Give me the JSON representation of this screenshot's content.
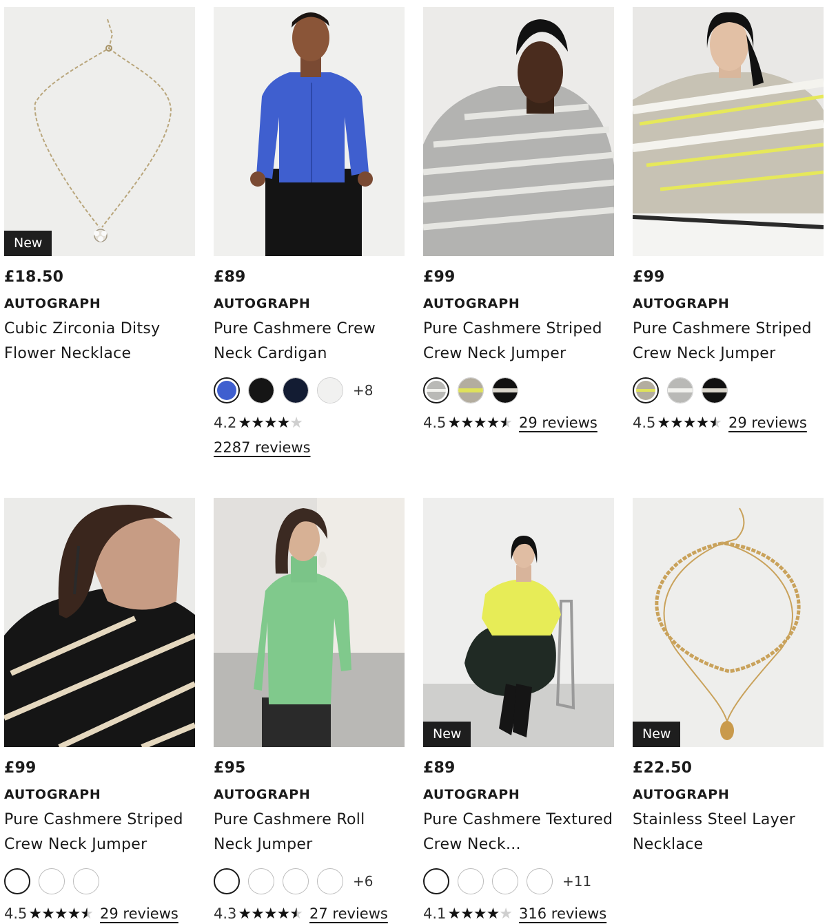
{
  "products": [
    {
      "price": "£18.50",
      "brand": "AUTOGRAPH",
      "title": "Cubic Zirconia Ditsy Flower Necklace",
      "badge": "New",
      "image": "necklace-flower-pendant"
    },
    {
      "price": "£89",
      "brand": "AUTOGRAPH",
      "title": "Pure Cashmere Crew Neck Cardigan",
      "swatches": [
        "#3f5fcf",
        "#151515",
        "#131c33",
        "#f1f1f0"
      ],
      "more_colours": "+8",
      "rating": "4.2",
      "rating_value": 4.2,
      "reviews": "2287 reviews",
      "image": "model-blue-cardigan"
    },
    {
      "price": "£99",
      "brand": "AUTOGRAPH",
      "title": "Pure Cashmere Striped Crew Neck Jumper",
      "swatches": [
        "grey-stripe",
        "oatmeal-yellow-stripe",
        "black-stripe"
      ],
      "rating": "4.5",
      "rating_value": 4.5,
      "reviews": "29 reviews",
      "image": "model-grey-striped-jumper"
    },
    {
      "price": "£99",
      "brand": "AUTOGRAPH",
      "title": "Pure Cashmere Striped Crew Neck Jumper",
      "swatches": [
        "oatmeal-yellow-stripe",
        "grey-stripe",
        "black-stripe"
      ],
      "rating": "4.5",
      "rating_value": 4.5,
      "reviews": "29 reviews",
      "image": "model-oatmeal-striped-jumper"
    },
    {
      "price": "£99",
      "brand": "AUTOGRAPH",
      "title": "Pure Cashmere Striped Crew Neck Jumper",
      "swatches": [
        "#ffffff",
        "#ffffff",
        "#ffffff"
      ],
      "rating": "4.5",
      "rating_value": 4.5,
      "reviews": "29 reviews",
      "image": "model-black-striped-jumper"
    },
    {
      "price": "£95",
      "brand": "AUTOGRAPH",
      "title": "Pure Cashmere Roll Neck Jumper",
      "swatches": [
        "#ffffff",
        "#ffffff",
        "#ffffff",
        "#ffffff"
      ],
      "more_colours": "+6",
      "rating": "4.3",
      "rating_value": 4.3,
      "reviews": "27 reviews",
      "image": "model-green-roll-neck"
    },
    {
      "price": "£89",
      "brand": "AUTOGRAPH",
      "title": "Pure Cashmere Textured Crew Neck...",
      "badge": "New",
      "swatches": [
        "#ffffff",
        "#ffffff",
        "#ffffff",
        "#ffffff"
      ],
      "more_colours": "+11",
      "rating": "4.1",
      "rating_value": 4.1,
      "reviews": "316 reviews",
      "image": "model-yellow-jumper-seated"
    },
    {
      "price": "£22.50",
      "brand": "AUTOGRAPH",
      "title": "Stainless Steel Layer Necklace",
      "badge": "New",
      "image": "necklace-gold-layer"
    }
  ]
}
